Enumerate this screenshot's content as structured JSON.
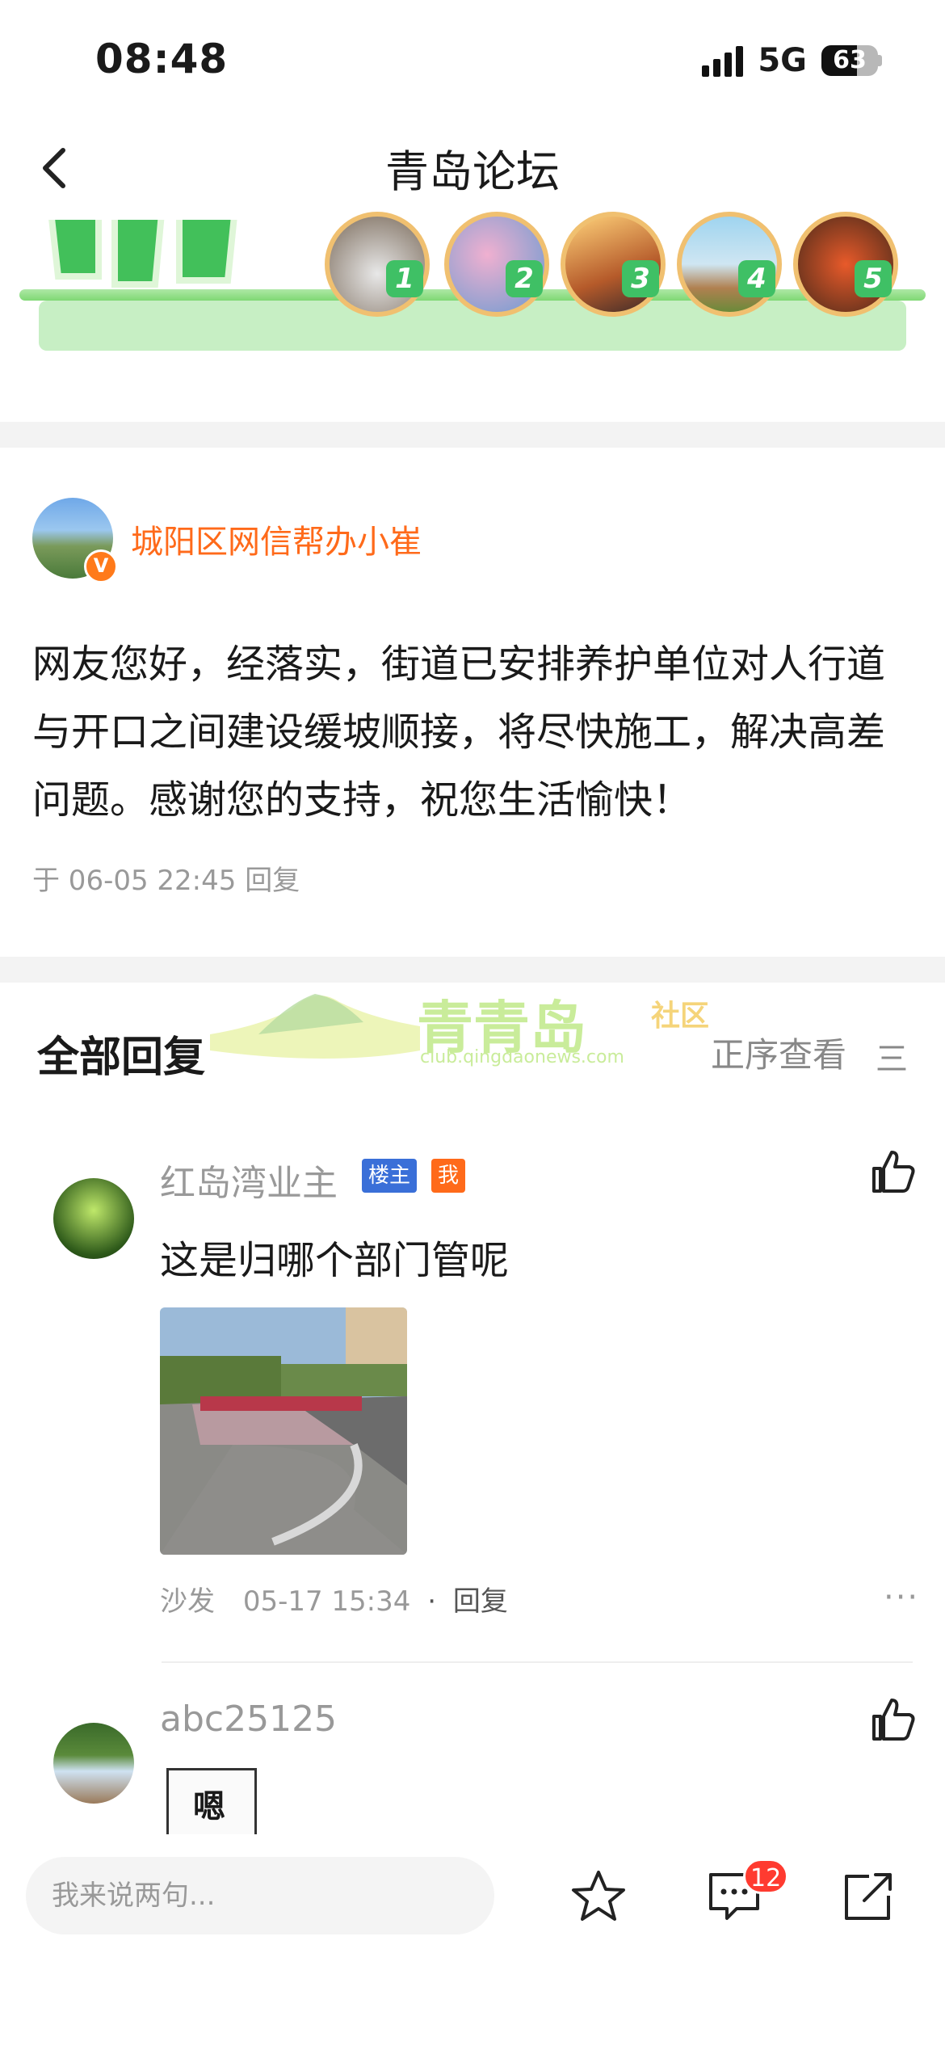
{
  "status": {
    "time": "08:48",
    "network": "5G",
    "battery": "63",
    "battery_level": 0.63
  },
  "nav": {
    "title": "青岛论坛"
  },
  "banner": {
    "numbers": [
      "1",
      "2",
      "3",
      "4",
      "5"
    ]
  },
  "author_reply": {
    "name": "城阳区网信帮办小崔",
    "text": "网友您好，经落实，街道已安排养护单位对人行道与开口之间建设缓坡顺接，将尽快施工，解决高差问题。感谢您的支持，祝您生活愉快！",
    "meta": "于 06-05 22:45 回复"
  },
  "replies_header": {
    "title": "全部回复",
    "sort": "正序查看",
    "sort_icon": "三",
    "watermark_main": "青青岛",
    "watermark_tag": "社区",
    "watermark_url": "club.qingdaonews.com"
  },
  "comments": [
    {
      "user": "红岛湾业主",
      "tags": [
        "楼主",
        "我"
      ],
      "text": "这是归哪个部门管呢",
      "floor": "沙发",
      "time": "05-17 15:34",
      "reply": "回复",
      "more": "···"
    },
    {
      "user": "abc25125",
      "sticker_text": "嗯"
    }
  ],
  "bottom": {
    "placeholder": "我来说两句...",
    "comment_count": "12"
  },
  "colors": {
    "accent": "#ff6a1a",
    "tag_owner": "#3a6fd8",
    "tag_me": "#ff6a1a",
    "badge": "#ff3b30"
  }
}
